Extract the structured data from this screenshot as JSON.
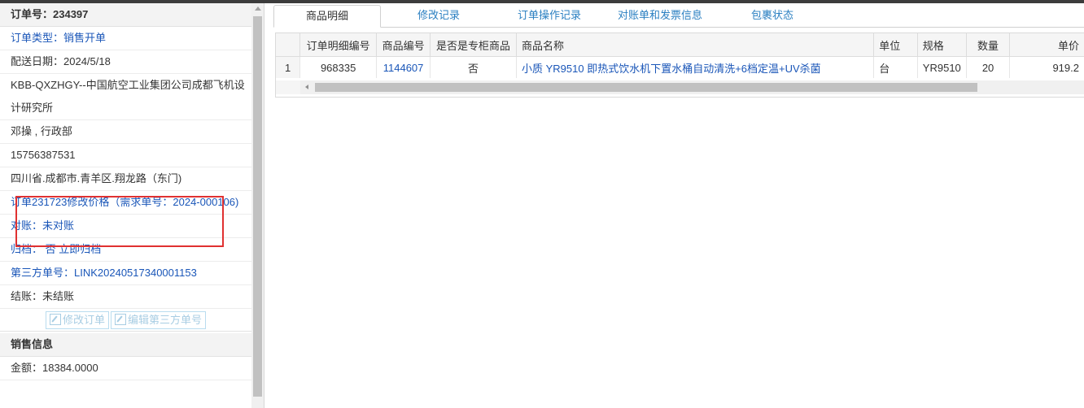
{
  "order": {
    "number_label": "订单号：234397",
    "fields": [
      {
        "text": "订单类型：销售开单",
        "blue": true
      },
      {
        "text": "配送日期：2024/5/18",
        "blue": false
      },
      {
        "text": "KBB-QXZHGY--中国航空工业集团公司成都飞机设计研究所",
        "blue": false
      },
      {
        "text": "邓操 , 行政部",
        "blue": false
      },
      {
        "text": "15756387531",
        "blue": false
      },
      {
        "text": "四川省.成都市.青羊区.翔龙路（东门)",
        "blue": false
      },
      {
        "text": "订单231723修改价格（需求单号：2024-000106)",
        "blue": true
      },
      {
        "text": "对账：未对账",
        "blue": true
      },
      {
        "text": "归档： 否 立即归档",
        "blue": true
      },
      {
        "text": "第三方单号：LINK20240517340001153",
        "blue": true
      },
      {
        "text": "结账：未结账",
        "blue": false
      }
    ],
    "buttons": {
      "edit_order": "修改订单",
      "edit_third": "编辑第三方单号"
    }
  },
  "sales": {
    "header": "销售信息",
    "amount": "金额：18384.0000"
  },
  "tabs": [
    "商品明细",
    "修改记录",
    "订单操作记录",
    "对账单和发票信息",
    "包裹状态"
  ],
  "active_tab": 0,
  "table": {
    "columns": [
      "订单明细编号",
      "商品编号",
      "是否是专柜商品",
      "商品名称",
      "单位",
      "规格",
      "数量",
      "单价"
    ],
    "rows": [
      {
        "rownum": "1",
        "detail_id": "968335",
        "product_id": "1144607",
        "is_counter": "否",
        "name": "小质 YR9510 即热式饮水机下置水桶自动清洗+6档定温+UV杀菌",
        "unit": "台",
        "spec": "YR9510",
        "qty": "20",
        "price": "919.2"
      }
    ]
  },
  "colors": {
    "link": "#1a56b8",
    "tab_link": "#2a7fc1",
    "highlight": "#e03131"
  }
}
